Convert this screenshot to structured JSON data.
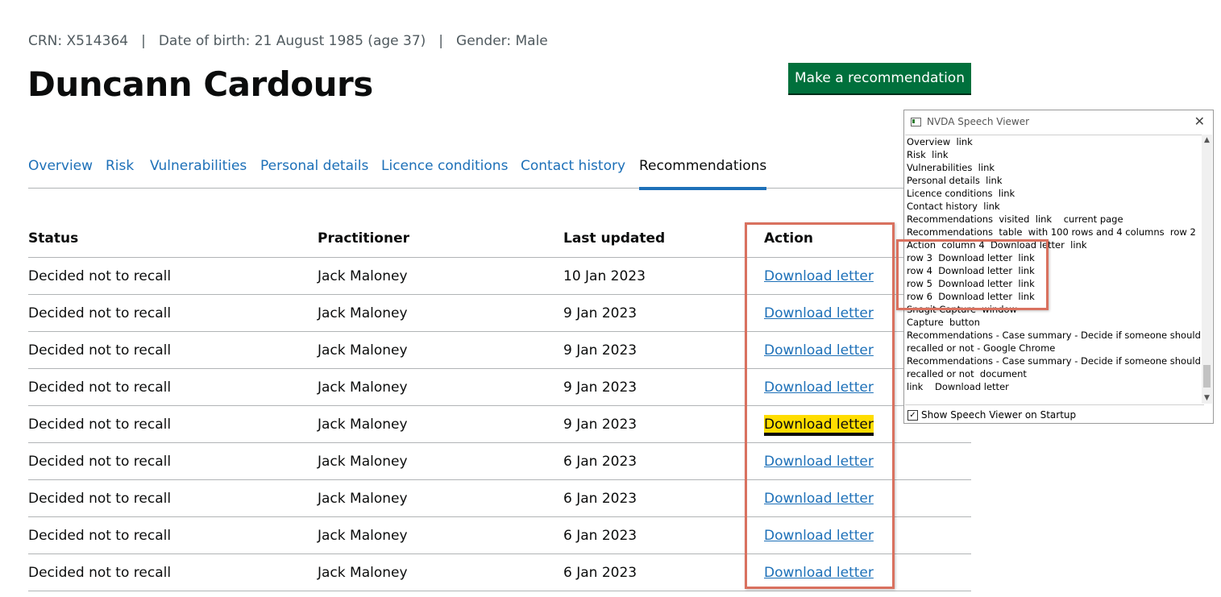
{
  "person": {
    "crn": "CRN: X514364",
    "dob": "Date of birth: 21 August 1985 (age 37)",
    "gender": "Gender: Male",
    "separator": "|",
    "name": "Duncann Cardours"
  },
  "cta": {
    "label": "Make a recommendation"
  },
  "tabs": [
    {
      "label": "Overview"
    },
    {
      "label": "Risk"
    },
    {
      "label": "Vulnerabilities"
    },
    {
      "label": "Personal details"
    },
    {
      "label": "Licence conditions"
    },
    {
      "label": "Contact history"
    },
    {
      "label": "Recommendations"
    }
  ],
  "table": {
    "headers": [
      "Status",
      "Practitioner",
      "Last updated",
      "Action"
    ],
    "rows": [
      {
        "status": "Decided not to recall",
        "practitioner": "Jack Maloney",
        "updated": "10 Jan 2023",
        "action": "Download letter"
      },
      {
        "status": "Decided not to recall",
        "practitioner": "Jack Maloney",
        "updated": "9 Jan 2023",
        "action": "Download letter"
      },
      {
        "status": "Decided not to recall",
        "practitioner": "Jack Maloney",
        "updated": "9 Jan 2023",
        "action": "Download letter"
      },
      {
        "status": "Decided not to recall",
        "practitioner": "Jack Maloney",
        "updated": "9 Jan 2023",
        "action": "Download letter"
      },
      {
        "status": "Decided not to recall",
        "practitioner": "Jack Maloney",
        "updated": "9 Jan 2023",
        "action": "Download letter"
      },
      {
        "status": "Decided not to recall",
        "practitioner": "Jack Maloney",
        "updated": "6 Jan 2023",
        "action": "Download letter"
      },
      {
        "status": "Decided not to recall",
        "practitioner": "Jack Maloney",
        "updated": "6 Jan 2023",
        "action": "Download letter"
      },
      {
        "status": "Decided not to recall",
        "practitioner": "Jack Maloney",
        "updated": "6 Jan 2023",
        "action": "Download letter"
      },
      {
        "status": "Decided not to recall",
        "practitioner": "Jack Maloney",
        "updated": "6 Jan 2023",
        "action": "Download letter"
      }
    ]
  },
  "nvda": {
    "title": "NVDA Speech Viewer",
    "close": "✕",
    "scroll_up": "▲",
    "scroll_down": "▼",
    "checkbox_mark": "✓",
    "lines": [
      "Overview  link",
      "Risk  link",
      "Vulnerabilities  link",
      "Personal details  link",
      "Licence conditions  link",
      "Contact history  link",
      "Recommendations  visited  link    current page",
      "Recommendations  table  with 100 rows and 4 columns  row 2",
      "Action  column 4  Download letter  link",
      "row 3  Download letter  link",
      "row 4  Download letter  link",
      "row 5  Download letter  link",
      "row 6  Download letter  link",
      "Snagit Capture  window",
      "Capture  button",
      "Recommendations - Case summary - Decide if someone should be",
      "recalled or not - Google Chrome",
      "Recommendations - Case summary - Decide if someone should be",
      "recalled or not  document",
      "link    Download letter"
    ],
    "footer_label": "Show Speech Viewer on Startup"
  },
  "colors": {
    "link": "#1d70b8",
    "focus": "#ffdd00",
    "button": "#00703c",
    "highlight_box": "#d9715f"
  }
}
